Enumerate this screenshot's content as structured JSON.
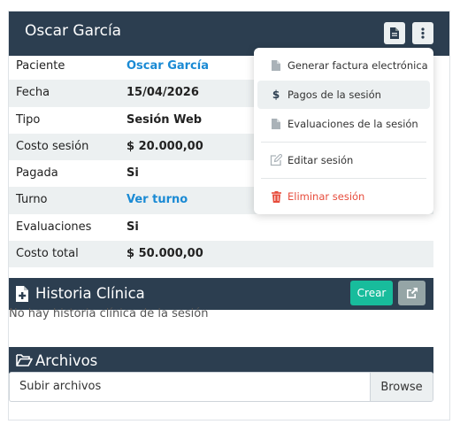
{
  "header": {
    "title": "Oscar García"
  },
  "details": [
    {
      "label": "Paciente",
      "value": "Oscar García",
      "link": true
    },
    {
      "label": "Fecha",
      "value": "15/04/2026",
      "link": false
    },
    {
      "label": "Tipo",
      "value": "Sesión Web",
      "link": false
    },
    {
      "label": "Costo sesión",
      "value": "$ 20.000,00",
      "link": false
    },
    {
      "label": "Pagada",
      "value": "Si",
      "link": false
    },
    {
      "label": "Turno",
      "value": "Ver turno",
      "link": true
    },
    {
      "label": "Evaluaciones",
      "value": "Si",
      "link": false
    },
    {
      "label": "Costo total",
      "value": "$ 50.000,00",
      "link": false
    }
  ],
  "historia": {
    "title": "Historia Clínica",
    "crear_label": "Crear",
    "empty_text": "No hay historia clínica de la sesión"
  },
  "archivos": {
    "title": "Archivos",
    "upload_placeholder": "Subir archivos",
    "browse_label": "Browse"
  },
  "menu": {
    "items": [
      {
        "label": "Generar factura electrónica",
        "icon": "file-icon"
      },
      {
        "label": "Pagos de la sesión",
        "icon": "dollar-icon"
      },
      {
        "label": "Evaluaciones de la sesión",
        "icon": "file-icon"
      },
      {
        "label": "Editar sesión",
        "icon": "edit-icon"
      },
      {
        "label": "Eliminar sesión",
        "icon": "trash-icon"
      }
    ]
  },
  "colors": {
    "header": "#2c3e50",
    "accent_link": "#1a8ad4",
    "success": "#18bc9c",
    "danger": "#e74c3c"
  }
}
